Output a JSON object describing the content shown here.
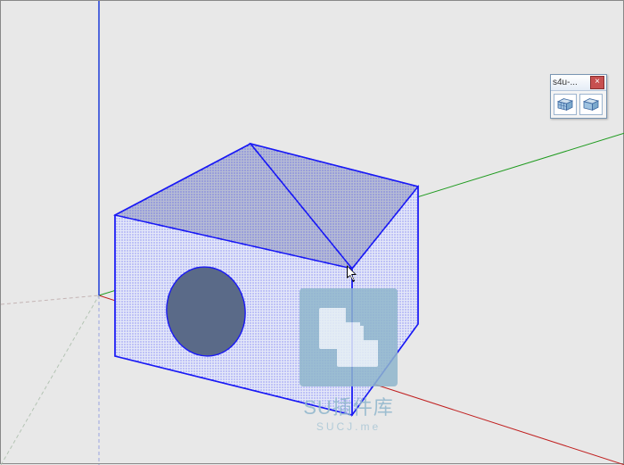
{
  "toolbar": {
    "title": "s4u-...",
    "close_glyph": "×",
    "tool1_name": "divide-tool-a",
    "tool2_name": "divide-tool-b"
  },
  "watermark": {
    "line1": "SU插件库",
    "line2": "SUCJ.me"
  },
  "axes": {
    "blue": "#1030d8",
    "green": "#1e9a1e",
    "red": "#c02020"
  },
  "model": {
    "edge_color": "#1a1af5",
    "face_fill": "#cfd6f3",
    "hole_fill": "#5a6a88",
    "top_shade": "#9aa4c0"
  }
}
